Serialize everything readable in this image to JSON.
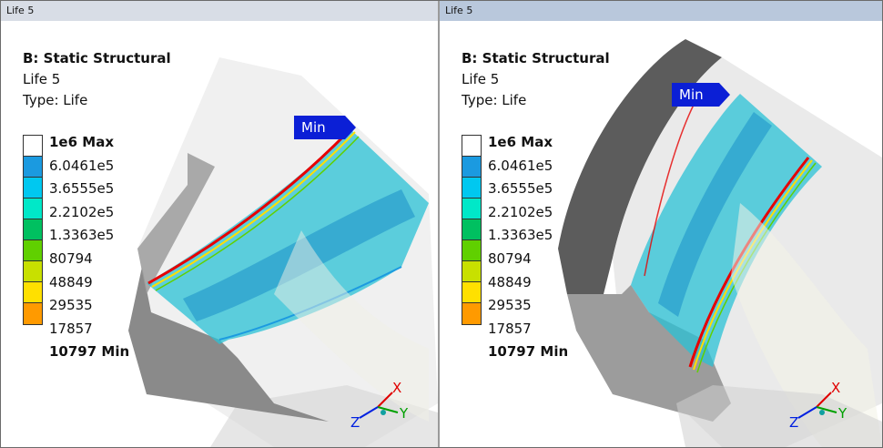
{
  "panes": [
    {
      "tab_title": "Life 5",
      "info": {
        "analysis": "B: Static Structural",
        "result": "Life 5",
        "type": "Type: Life"
      },
      "probe_label": "Min"
    },
    {
      "tab_title": "Life 5",
      "info": {
        "analysis": "B: Static Structural",
        "result": "Life 5",
        "type": "Type: Life"
      },
      "probe_label": "Min"
    }
  ],
  "legend": {
    "entries": [
      "1e6 Max",
      "6.0461e5",
      "3.6555e5",
      "2.2102e5",
      "1.3363e5",
      "80794",
      "48849",
      "29535",
      "17857",
      "10797 Min"
    ],
    "colors": [
      "#ffffff",
      "#1b9ae0",
      "#00c8f0",
      "#00e8c8",
      "#00c060",
      "#60d000",
      "#c8e000",
      "#ffe000",
      "#ff9a00",
      "#e60000"
    ]
  },
  "triad": {
    "x": "X",
    "y": "Y",
    "z": "Z"
  }
}
